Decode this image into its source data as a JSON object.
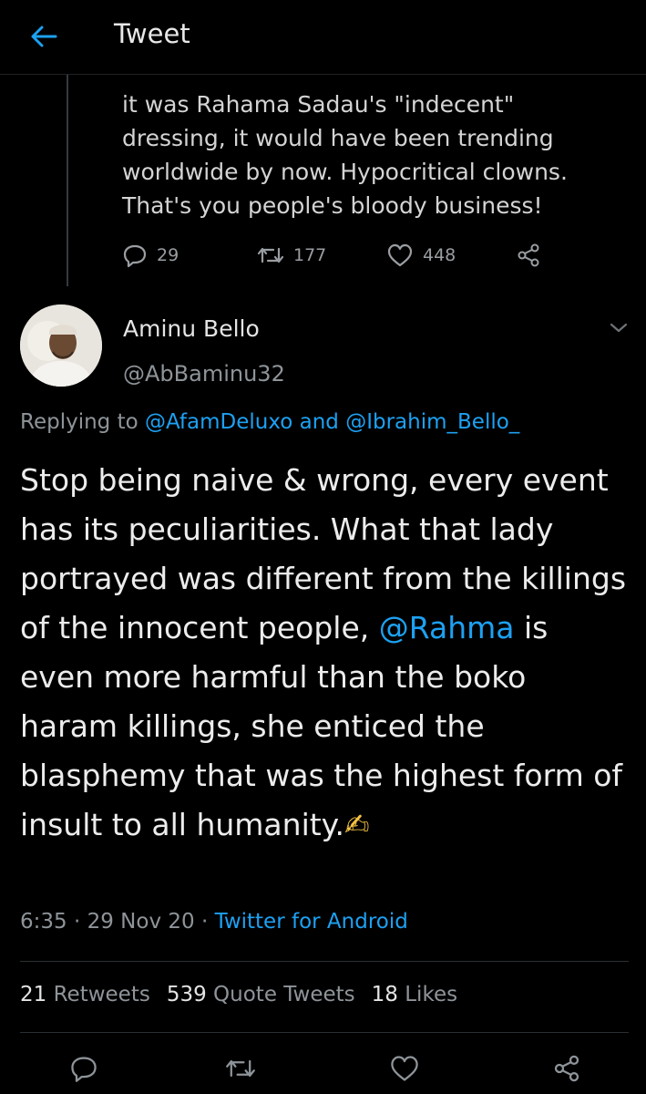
{
  "header": {
    "title": "Tweet",
    "back_icon": "arrow-left-icon"
  },
  "previous_tweet": {
    "lines": [
      "it was Rahama Sadau's \"indecent\"",
      "dressing, it would have been trending",
      "worldwide by now. Hypocritical clowns.",
      "That's you people's bloody business!"
    ],
    "replies": "29",
    "retweets": "177",
    "likes": "448"
  },
  "tweet": {
    "author_name": "Aminu Bello",
    "author_handle": "@AbBaminu32",
    "replying_prefix": "Replying to",
    "replying_user1": "@AfamDeluxo",
    "replying_and": "and",
    "replying_user2": "@Ibrahim_Bello_",
    "text_before_mention": "Stop being naive & wrong, every event has its peculiarities. What that lady portrayed was different from the killings of the innocent people, ",
    "mention": "@Rahma",
    "text_after_mention": " is even more harmful than the boko haram killings, she enticed the blasphemy that was the highest form of insult to all humanity.",
    "emoji": "✍",
    "time": "6:35",
    "date": "29 Nov 20",
    "separator": "·",
    "source": "Twitter for Android",
    "stats": {
      "retweets_count": "21",
      "retweets_label": "Retweets",
      "quote_count": "539",
      "quote_label": "Quote Tweets",
      "likes_count": "18",
      "likes_label": "Likes"
    }
  },
  "colors": {
    "accent": "#1da1f2",
    "background": "#000000",
    "muted": "#8e9499"
  }
}
